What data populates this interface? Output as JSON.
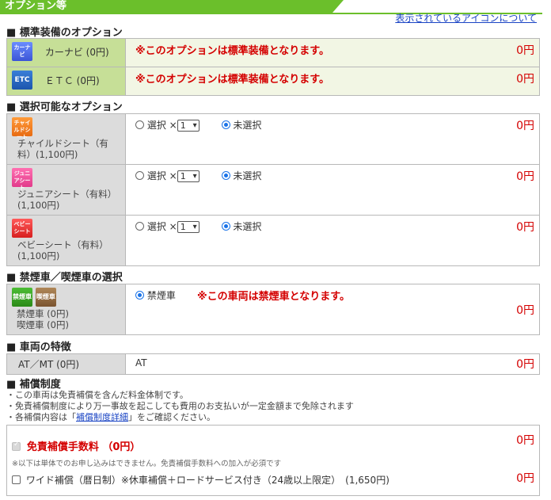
{
  "header": {
    "title": "オプション等",
    "icon_link": "表示されているアイコンについて"
  },
  "sections": {
    "standard": "■ 標準装備のオプション",
    "selectable": "■ 選択可能なオプション",
    "smoking": "■ 禁煙車／喫煙車の選択",
    "features": "■ 車両の特徴",
    "insurance": "■ 補償制度"
  },
  "standard_items": [
    {
      "icon": "navigation-icon",
      "badge": "カーナビ",
      "name": "カーナビ (0円)",
      "note": "※このオプションは標準装備となります。",
      "price": "0円"
    },
    {
      "icon": "etc-icon",
      "badge": "ETC",
      "name": "ＥＴＣ (0円)",
      "note": "※このオプションは標準装備となります。",
      "price": "0円"
    }
  ],
  "selectable_items": [
    {
      "icon": "child-seat-icon",
      "badge": "チャイルドシート",
      "name": "チャイルドシート（有料）(1,100円)",
      "select_label": "選択 ×",
      "qty": "1",
      "unselect_label": "未選択",
      "price": "0円"
    },
    {
      "icon": "junior-seat-icon",
      "badge": "ジュニアシート",
      "name": "ジュニアシート（有料）(1,100円)",
      "select_label": "選択 ×",
      "qty": "1",
      "unselect_label": "未選択",
      "price": "0円"
    },
    {
      "icon": "baby-seat-icon",
      "badge": "ベビーシート",
      "name": "ベビーシート（有料）(1,100円)",
      "select_label": "選択 ×",
      "qty": "1",
      "unselect_label": "未選択",
      "price": "0円"
    }
  ],
  "smoking": {
    "badge_nonsmoking": "禁煙車",
    "badge_smoking": "喫煙車",
    "label_nonsmoking": "禁煙車 (0円)",
    "label_smoking": "喫煙車 (0円)",
    "option": "禁煙車",
    "note": "※この車両は禁煙車となります。",
    "price": "0円"
  },
  "features": {
    "label": "AT／MT (0円)",
    "value": "AT",
    "price": "0円"
  },
  "insurance": {
    "line1": "・この車両は免責補償を含んだ料金体制です。",
    "line2": "・免責補償制度により万一事故を起こしても費用のお支払いが一定金額まで免除されます",
    "line3_pre": "・各補償内容は「",
    "line3_link": "補償制度詳細",
    "line3_post": "」をご確認ください。",
    "cdw_label": "免責補償手数料 （0円）",
    "cdw_price": "0円",
    "cdw_note": "※以下は単体でのお申し込みはできません。免責補償手数料への加入が必須です",
    "wide_label": "ワイド補償（暦日制）※休車補償＋ロードサービス付き（24歳以上限定）　(1,650円)",
    "wide_price": "0円"
  }
}
